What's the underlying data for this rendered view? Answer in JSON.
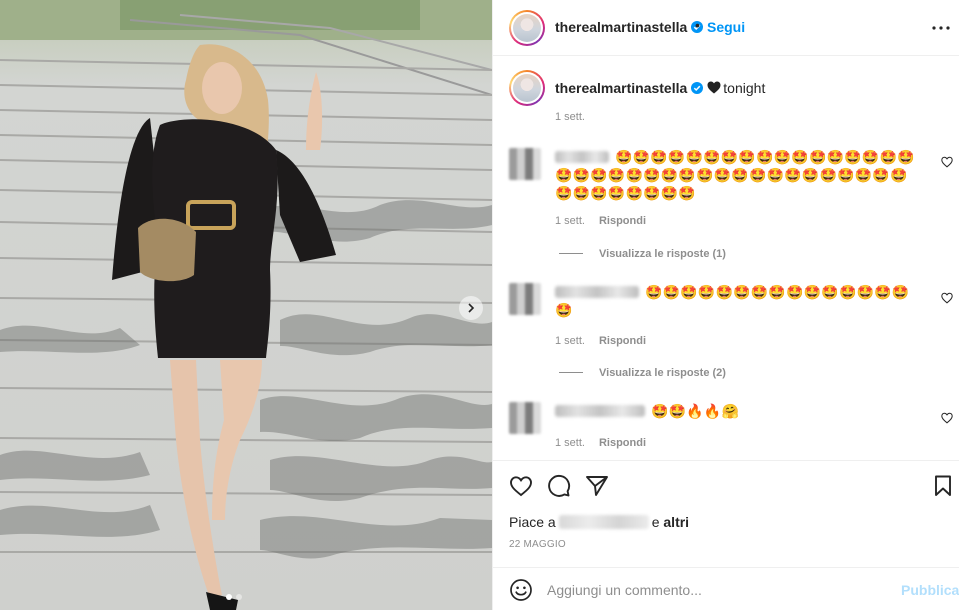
{
  "post": {
    "username": "therealmartinastella",
    "follow_label": "Segui",
    "separator": "•",
    "caption_text": "tonight",
    "caption_time": "1 sett."
  },
  "comments": [
    {
      "text": "🤩🤩🤩🤩🤩🤩🤩🤩🤩🤩🤩🤩🤩🤩🤩🤩🤩🤩🤩🤩🤩🤩🤩🤩🤩🤩🤩🤩🤩🤩🤩🤩🤩🤩🤩🤩🤩🤩🤩🤩🤩🤩🤩🤩🤩",
      "time": "1 sett.",
      "reply_label": "Rispondi",
      "view_replies": "Visualizza le risposte (1)"
    },
    {
      "text": "🤩🤩🤩🤩🤩🤩🤩🤩🤩🤩🤩🤩🤩🤩🤩🤩",
      "time": "1 sett.",
      "reply_label": "Rispondi",
      "view_replies": "Visualizza le risposte (2)"
    },
    {
      "text": "🤩🤩🔥🔥🤗",
      "time": "1 sett.",
      "reply_label": "Rispondi"
    }
  ],
  "likes": {
    "prefix": "Piace a",
    "and_label": "e",
    "others_label": "altri"
  },
  "date": "22 MAGGIO",
  "add_comment": {
    "placeholder": "Aggiungi un commento...",
    "publish_label": "Pubblica"
  },
  "icons": {
    "verified": "verified-badge-icon",
    "more": "more-options-icon",
    "like": "heart-icon",
    "comment": "comment-icon",
    "share": "paper-plane-icon",
    "save": "bookmark-icon",
    "emoji": "smiley-icon",
    "next": "chevron-right-icon"
  },
  "colors": {
    "accent": "#0095f6",
    "muted": "#8e8e8e",
    "publish_disabled": "#b2dffc",
    "text": "#262626"
  }
}
